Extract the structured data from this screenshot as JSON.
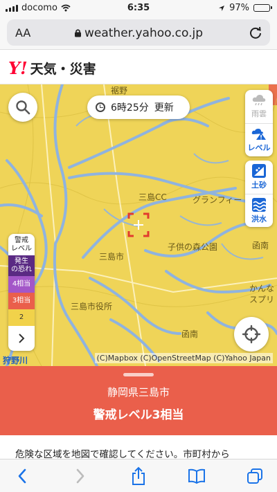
{
  "status_bar": {
    "carrier": "docomo",
    "time": "6:35",
    "battery": "97%"
  },
  "browser": {
    "aa_label": "AA",
    "url": "weather.yahoo.co.jp"
  },
  "site": {
    "logo_mark": "Y!",
    "title": "天気・災害"
  },
  "map": {
    "updated_time": "6時25分",
    "updated_suffix": "更新",
    "layers": [
      {
        "label": "雨雲",
        "icon": "cloud-icon",
        "state": "inactive"
      },
      {
        "label": "レベル",
        "icon": "warning-level-icon",
        "state": "active"
      },
      {
        "label": "土砂",
        "icon": "landslide-icon",
        "state": "active"
      },
      {
        "label": "洪水",
        "icon": "flood-icon",
        "state": "active"
      }
    ],
    "legend": {
      "title_line1": "警戒",
      "title_line2": "レベル",
      "levels": [
        {
          "label_line1": "発生",
          "label_line2": "の恐れ",
          "color": "#5a2a83"
        },
        {
          "label_line1": "4相当",
          "label_line2": "",
          "color": "#a356c8"
        },
        {
          "label_line1": "3相当",
          "label_line2": "",
          "color": "#ea5f4b"
        },
        {
          "label_line1": "2",
          "label_line2": "",
          "color": "#f1d24a"
        }
      ]
    },
    "place_labels": [
      "裾野",
      "三島CC",
      "グランフィー",
      "子供の森公園",
      "三島市",
      "函南",
      "三島市役所",
      "かんな",
      "スプリ",
      "函南",
      "狩野川"
    ],
    "attribution": "(C)Mapbox (C)OpenStreetMap (C)Yahoo Japan",
    "colors": {
      "level2": "#efd458",
      "river": "#8fb3df",
      "level3": "#ea5f4b"
    }
  },
  "alert": {
    "place": "静岡県三島市",
    "level": "警戒レベル3相当",
    "notice": "危険な区域を地図で確認してください。市町村から"
  }
}
